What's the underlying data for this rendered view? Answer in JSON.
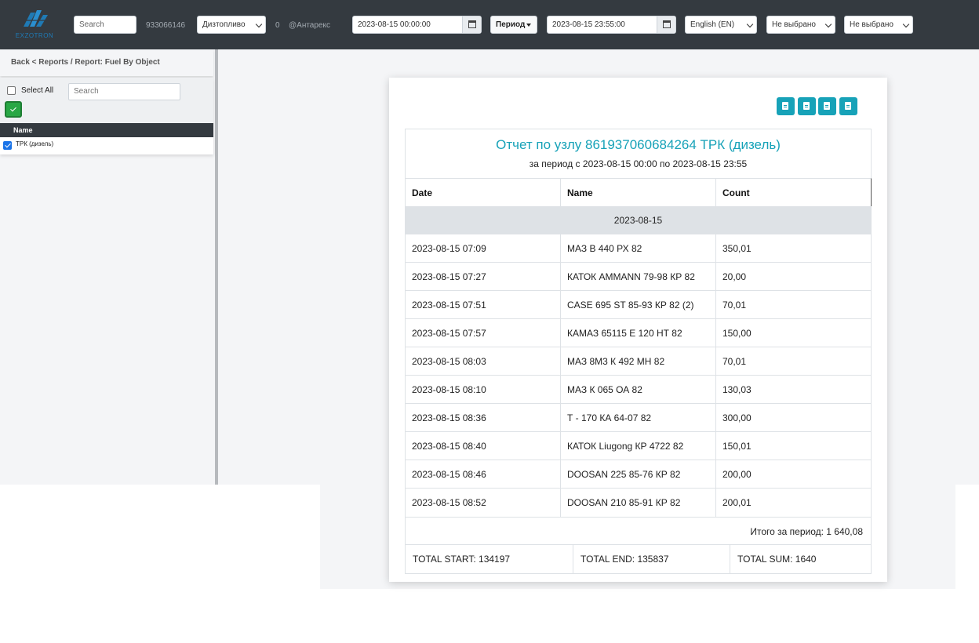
{
  "topbar": {
    "logo_text": "EXZOTRON",
    "search_placeholder": "Search",
    "phone": "933066146",
    "fuel_select": "Дизтопливо",
    "count": "0",
    "company": "@Антарекс",
    "date_from": "2023-08-15 00:00:00",
    "period_label": "Период",
    "date_to": "2023-08-15 23:55:00",
    "language": "English (EN)",
    "filter1": "Не выбрано",
    "filter2": "Не выбрано"
  },
  "sidebar": {
    "breadcrumb": "Back < Reports / Report: Fuel By Object",
    "select_all_label": "Select All",
    "search_placeholder": "Search",
    "list_header": "Name",
    "items": [
      {
        "label": "ТРК (дизель)",
        "checked": true
      }
    ]
  },
  "report": {
    "title": "Отчет по узлу 861937060684264 ТРК (дизель)",
    "subtitle": "за период с 2023-08-15 00:00 по 2023-08-15 23:55",
    "columns": [
      "Date",
      "Name",
      "Count"
    ],
    "group_date": "2023-08-15",
    "rows": [
      {
        "date": "2023-08-15 07:09",
        "name": "МАЗ В 440 РХ 82",
        "count": "350,01"
      },
      {
        "date": "2023-08-15 07:27",
        "name": "КАТОК AMMANN 79-98 КР 82",
        "count": "20,00"
      },
      {
        "date": "2023-08-15 07:51",
        "name": "CASE 695 ST 85-93 КР 82 (2)",
        "count": "70,01"
      },
      {
        "date": "2023-08-15 07:57",
        "name": "КАМАЗ 65115 Е 120 НТ 82",
        "count": "150,00"
      },
      {
        "date": "2023-08-15 08:03",
        "name": "МАЗ 8М3 К 492 МН 82",
        "count": "70,01"
      },
      {
        "date": "2023-08-15 08:10",
        "name": "МАЗ К 065 ОА 82",
        "count": "130,03"
      },
      {
        "date": "2023-08-15 08:36",
        "name": "Т - 170 КА 64-07 82",
        "count": "300,00"
      },
      {
        "date": "2023-08-15 08:40",
        "name": "КАТОК Liugong КР 4722 82",
        "count": "150,01"
      },
      {
        "date": "2023-08-15 08:46",
        "name": "DOOSAN 225 85-76 КР 82",
        "count": "200,00"
      },
      {
        "date": "2023-08-15 08:52",
        "name": "DOOSAN 210 85-91 КР 82",
        "count": "200,01"
      }
    ],
    "period_total": "Итого за период: 1 640,08",
    "total_start": "TOTAL START: 134197",
    "total_end": "TOTAL END: 135837",
    "total_sum": "TOTAL SUM: 1640"
  },
  "colors": {
    "topbar": "#343a40",
    "accent": "#17a2b8",
    "apply": "#28a745"
  }
}
